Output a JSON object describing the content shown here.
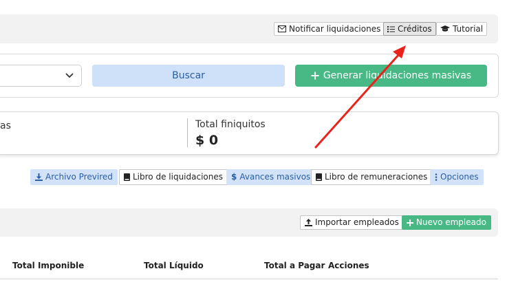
{
  "header": {
    "notify_label": "Notificar liquidaciones",
    "credits_label": "Créditos",
    "tutorial_label": "Tutorial"
  },
  "filters": {
    "select_value": "",
    "search_label": "Buscar",
    "generate_label": "Generar liquidaciones masivas"
  },
  "summary": {
    "left_label_fragment": "as",
    "total_finiquitos_label": "Total finiquitos",
    "total_finiquitos_value": "$ 0"
  },
  "actions": {
    "previred_label": "Archivo Previred",
    "libro_liq_label": "Libro de liquidaciones",
    "avances_label": "Avances masivos",
    "libro_rem_label": "Libro de remuneraciones",
    "opciones_label": "Opciones"
  },
  "employees": {
    "import_label": "Importar empleados",
    "new_label": "Nuevo empleado"
  },
  "table": {
    "columns": [
      "Total Imponible",
      "Total Líquido",
      "Total a Pagar",
      "Acciones"
    ]
  },
  "colors": {
    "primary_blue": "#2a5ea8",
    "light_blue": "#cfe0f9",
    "green": "#48b884",
    "annotation_red": "#e8231c"
  }
}
